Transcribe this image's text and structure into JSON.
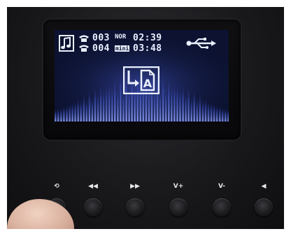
{
  "screen": {
    "line1": {
      "track": "003",
      "mode": "NOR",
      "time": "02:39"
    },
    "line2": {
      "track": "004",
      "badge": "mini",
      "time": "03:48"
    },
    "icons": {
      "music": "music-note-icon",
      "phone": "telephone-icon",
      "usb": "usb-icon",
      "center": "file-transfer-icon"
    },
    "center_letter": "A"
  },
  "buttons": [
    {
      "name": "repeat",
      "label": "⟲",
      "icon": "repeat-icon"
    },
    {
      "name": "rewind",
      "label": "◀◀",
      "icon": "rewind-icon"
    },
    {
      "name": "fast-forward",
      "label": "▶▶",
      "icon": "fast-forward-icon"
    },
    {
      "name": "volume-up",
      "label": "V+",
      "icon": ""
    },
    {
      "name": "volume-down",
      "label": "V-",
      "icon": ""
    },
    {
      "name": "speaker",
      "label": "◀",
      "icon": "speaker-icon"
    }
  ],
  "colors": {
    "device": "#19191c",
    "screen_bg": "#0c1230",
    "screen_fg": "#eaf0ff",
    "eq": "#5a6fd6"
  }
}
